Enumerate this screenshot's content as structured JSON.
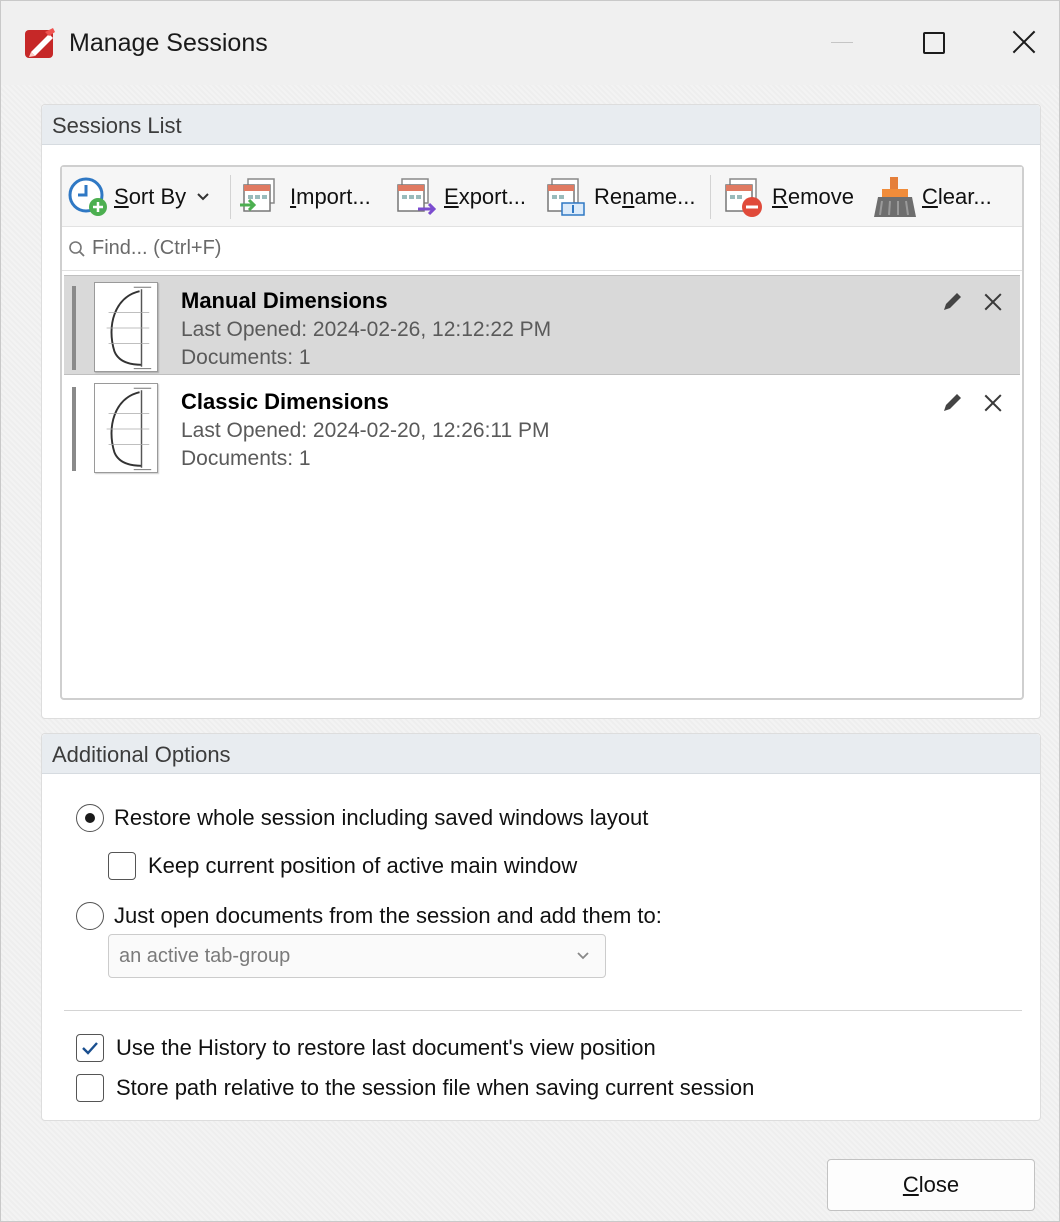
{
  "window": {
    "title": "Manage Sessions",
    "icons": {
      "app": "pdf-editor-logo-icon",
      "minimize": "minimize-icon",
      "maximize": "maximize-icon",
      "close": "close-icon"
    }
  },
  "sessions_group": {
    "header": "Sessions List",
    "toolbar": {
      "sort_by": {
        "mnemonic": "S",
        "rest": "ort By",
        "icon": "sort-clock-plus-icon",
        "dropdown_icon": "chevron-down-icon"
      },
      "import": {
        "mnemonic": "I",
        "rest": "mport...",
        "icon": "import-sessions-icon"
      },
      "export": {
        "mnemonic": "E",
        "rest": "xport...",
        "icon": "export-sessions-icon"
      },
      "rename": {
        "pre": "Re",
        "mnemonic": "n",
        "rest": "ame...",
        "icon": "rename-session-icon"
      },
      "remove": {
        "mnemonic": "R",
        "rest": "emove",
        "icon": "remove-session-icon"
      },
      "clear": {
        "mnemonic": "C",
        "rest": "lear...",
        "icon": "broom-clear-icon"
      }
    },
    "find_placeholder": "Find... (Ctrl+F)",
    "sessions": [
      {
        "name": "Manual Dimensions",
        "last_opened": "Last Opened: 2024-02-26, 12:12:22 PM",
        "documents": "Documents: 1",
        "selected": true
      },
      {
        "name": "Classic Dimensions",
        "last_opened": "Last Opened: 2024-02-20, 12:26:11 PM",
        "documents": "Documents: 1",
        "selected": false
      }
    ]
  },
  "options_group": {
    "header": "Additional Options",
    "restore_whole": {
      "label": "Restore whole session including saved windows layout",
      "selected": true
    },
    "keep_position": {
      "label": "Keep current position of active main window",
      "checked": false
    },
    "just_open": {
      "label": "Just open documents from the session and add them to:",
      "selected": false
    },
    "target_select": {
      "value": "an active tab-group"
    },
    "use_history": {
      "label": "Use the History to restore last document's view position",
      "checked": true
    },
    "store_relative": {
      "label": "Store path relative to the session file when saving current session",
      "checked": false
    }
  },
  "footer": {
    "close_button": {
      "mnemonic": "C",
      "rest": "lose"
    }
  },
  "colors": {
    "selected_row": "#d9d9d9",
    "group_header": "#e8ecf0",
    "accent_blue": "#2f78c4",
    "accent_green": "#4caf50",
    "accent_red": "#e04a3a"
  }
}
